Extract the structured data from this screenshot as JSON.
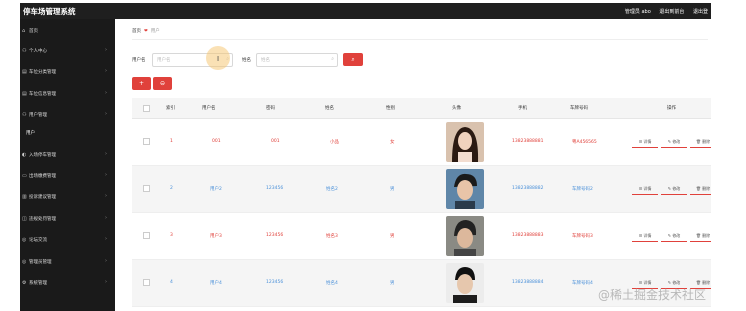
{
  "header": {
    "brand": "停车场管理系统",
    "links": [
      "管理员 abo",
      "退出到前台",
      "退出登"
    ]
  },
  "sidebar": {
    "items": [
      {
        "icon": "⌂",
        "label": "首页",
        "chev": ""
      },
      {
        "icon": "⚇",
        "label": "个人中心",
        "chev": "›"
      },
      {
        "icon": "▤",
        "label": "车位分类管理",
        "chev": "›"
      },
      {
        "icon": "▤",
        "label": "车位信息管理",
        "chev": "›"
      },
      {
        "icon": "⚇",
        "label": "用户管理",
        "chev": "›"
      },
      {
        "icon": "",
        "label": "用户",
        "chev": ""
      },
      {
        "icon": "◐",
        "label": "入场停车管理",
        "chev": "›"
      },
      {
        "icon": "▭",
        "label": "出场缴费管理",
        "chev": "›"
      },
      {
        "icon": "▥",
        "label": "投诉建议管理",
        "chev": "›"
      },
      {
        "icon": "◫",
        "label": "违规处罚管理",
        "chev": "›"
      },
      {
        "icon": "◎",
        "label": "论坛交流",
        "chev": "›"
      },
      {
        "icon": "◎",
        "label": "管理员管理",
        "chev": "›"
      },
      {
        "icon": "⚙",
        "label": "系统管理",
        "chev": "›"
      }
    ]
  },
  "breadcrumb": {
    "home": "首页",
    "current": "用户"
  },
  "search": {
    "username_label": "用户名",
    "username_placeholder": "用户名",
    "name_label": "姓名",
    "name_placeholder": "姓名",
    "search_icon": "⌕"
  },
  "actions": {
    "add_icon": "+",
    "delete_icon": "⊖"
  },
  "table": {
    "columns": [
      "索引",
      "用户名",
      "密码",
      "姓名",
      "性别",
      "头像",
      "手机",
      "车牌号码",
      "操作"
    ],
    "rows": [
      {
        "index": "1",
        "username": "001",
        "password": "001",
        "name": "小品",
        "gender": "女",
        "phone": "13823888881",
        "plate": "粤A456565"
      },
      {
        "index": "2",
        "username": "用户2",
        "password": "123456",
        "name": "姓名2",
        "gender": "男",
        "phone": "13823888882",
        "plate": "车牌号码2"
      },
      {
        "index": "3",
        "username": "用户3",
        "password": "123456",
        "name": "姓名3",
        "gender": "男",
        "phone": "13823888883",
        "plate": "车牌号码3"
      },
      {
        "index": "4",
        "username": "用户4",
        "password": "123456",
        "name": "姓名4",
        "gender": "男",
        "phone": "13823888884",
        "plate": "车牌号码4"
      }
    ],
    "ops": [
      "详情",
      "修改",
      "删除"
    ]
  },
  "colors": {
    "accent": "#e0413b",
    "link_blue": "#4a90d9",
    "row_red": "#e0413b"
  },
  "watermark": "@稀土掘金技术社区"
}
